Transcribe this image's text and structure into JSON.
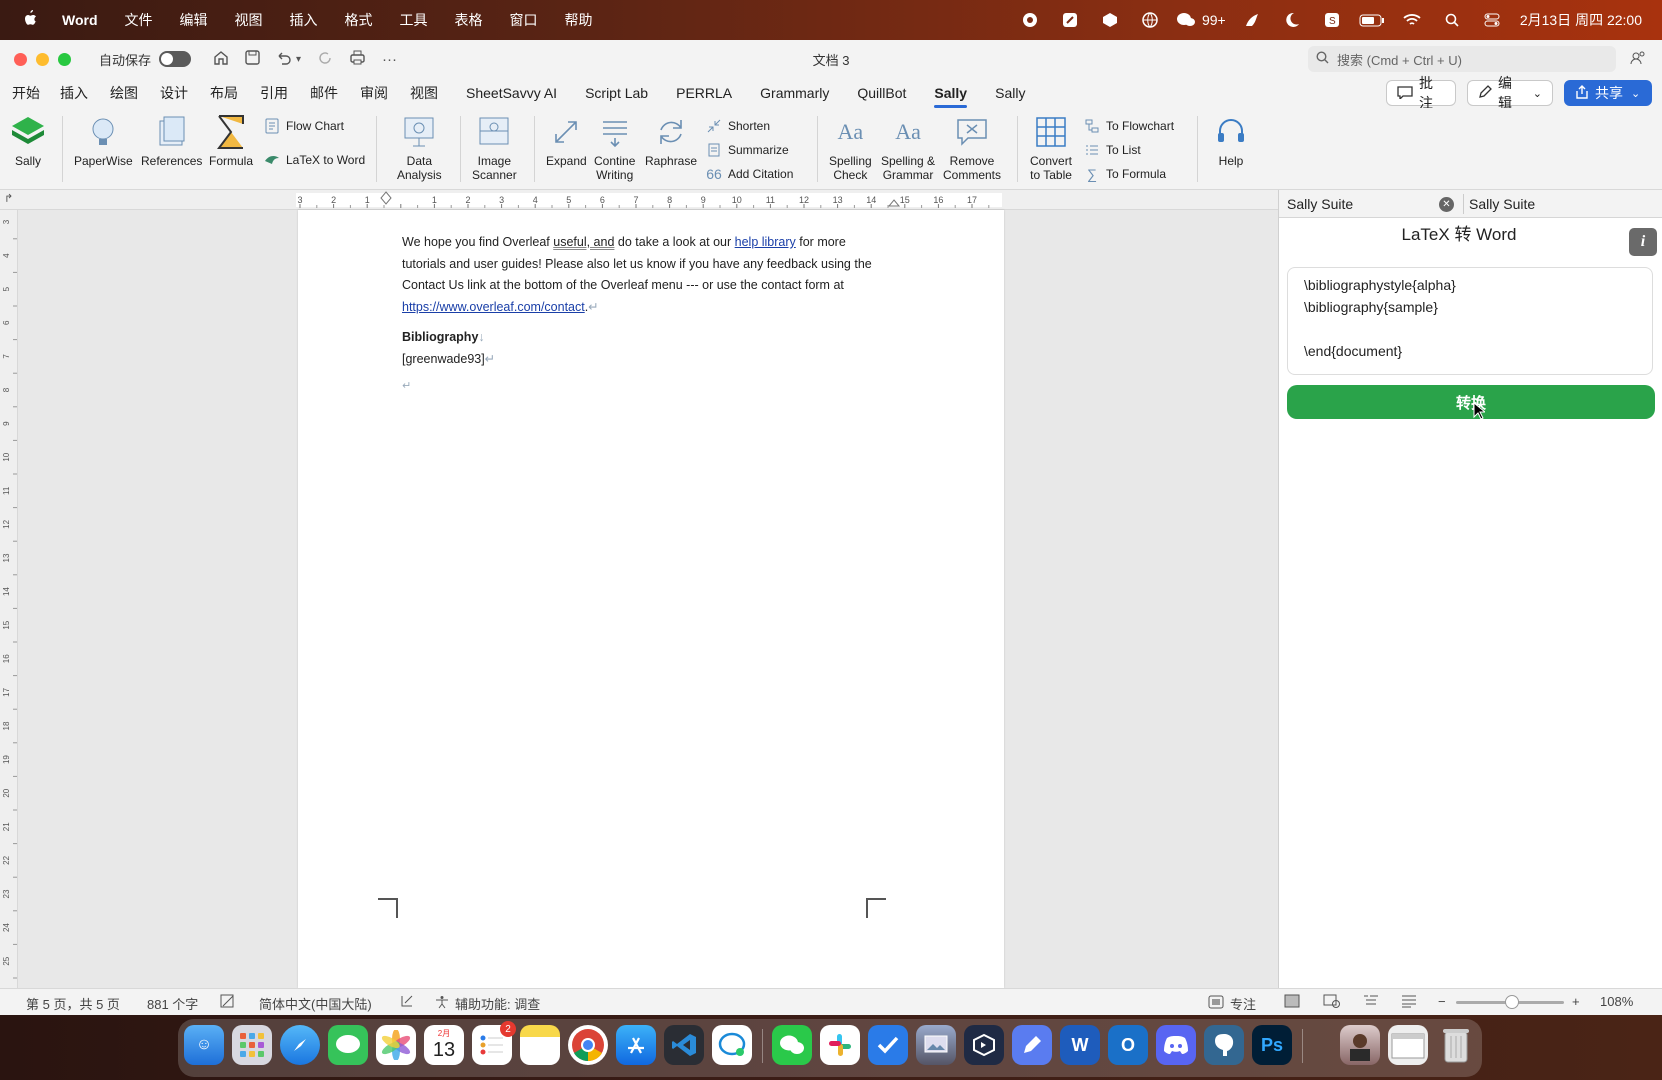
{
  "menubar": {
    "apple": "",
    "items": [
      "Word",
      "文件",
      "编辑",
      "视图",
      "插入",
      "格式",
      "工具",
      "表格",
      "窗口",
      "帮助"
    ],
    "status_badge": "99+",
    "clock": "2月13日 周四 22:00"
  },
  "titlebar": {
    "autosave_label": "自动保存",
    "doc_title": "文档 3",
    "search_placeholder": "搜索 (Cmd + Ctrl + U)"
  },
  "tabs": {
    "items": [
      "开始",
      "插入",
      "绘图",
      "设计",
      "布局",
      "引用",
      "邮件",
      "审阅",
      "视图",
      "SheetSavvy AI",
      "Script Lab",
      "PERRLA",
      "Grammarly",
      "QuillBot",
      "Sally",
      "Sally"
    ],
    "active_index": 14,
    "comments_label": "批注",
    "edit_label": "编辑",
    "share_label": "共享"
  },
  "ribbon": {
    "sally": "Sally",
    "paperwise": "PaperWise",
    "references": "References",
    "formula": "Formula",
    "flow_chart": "Flow Chart",
    "latex_to_word": "LaTeX to Word",
    "data_analysis_1": "Data",
    "data_analysis_2": "Analysis",
    "image_scanner_1": "Image",
    "image_scanner_2": "Scanner",
    "expand": "Expand",
    "continue_1": "Contine",
    "continue_2": "Writing",
    "raphrase": "Raphrase",
    "shorten": "Shorten",
    "summarize": "Summarize",
    "add_citation": "Add Citation",
    "spelling_1": "Spelling",
    "spelling_2": "Check",
    "sg_1": "Spelling &",
    "sg_2": "Grammar",
    "remove_1": "Remove",
    "remove_2": "Comments",
    "convert_1": "Convert",
    "convert_2": "to Table",
    "to_flowchart": "To Flowchart",
    "to_list": "To List",
    "to_formula": "To Formula",
    "help": "Help"
  },
  "ruler": {
    "ticks": [
      "3",
      "2",
      "1",
      "",
      "1",
      "2",
      "3",
      "4",
      "5",
      "6",
      "7",
      "8",
      "9",
      "10",
      "11",
      "12",
      "13",
      "14",
      "15",
      "16",
      "17"
    ],
    "vticks": [
      "3",
      "4",
      "5",
      "6",
      "7",
      "8",
      "9",
      "10",
      "11",
      "12",
      "13",
      "14",
      "15",
      "16",
      "17",
      "18",
      "19",
      "20",
      "21",
      "22",
      "23",
      "24",
      "25"
    ]
  },
  "document": {
    "p1_a": "We hope you find Overleaf ",
    "p1_b": "useful, and",
    "p1_c": " do take a look at our ",
    "p1_link1": "help library",
    "p1_d": " for more tutorials and user guides! Please also let us know if you have any feedback using the Contact Us link at the bottom of the Overleaf menu --- or use the contact form at ",
    "p1_link2": "https://www.overleaf.com/contact",
    "p1_e": ".",
    "bib_heading": "Bibliography",
    "bib_entry": "[greenwade93]"
  },
  "pane": {
    "tab1": "Sally Suite",
    "tab2": "Sally Suite",
    "title": "LaTeX 转 Word",
    "info": "i",
    "textarea_value": "\\bibliographystyle{alpha}\n\\bibliography{sample}\n\n\\end{document}",
    "convert_label": "转换"
  },
  "status": {
    "page": "第 5 页，共 5 页",
    "words": "881 个字",
    "language": "简体中文(中国大陆)",
    "accessibility": "辅助功能: 调查",
    "focus": "专注",
    "zoom": "108%"
  },
  "dock": {
    "calendar_month": "2月",
    "calendar_day": "13",
    "reminders_badge": "2",
    "ps": "Ps"
  },
  "colors": {
    "accent": "#2a6ad6",
    "convert_green": "#2aa34a",
    "link": "#1a3fa8"
  }
}
